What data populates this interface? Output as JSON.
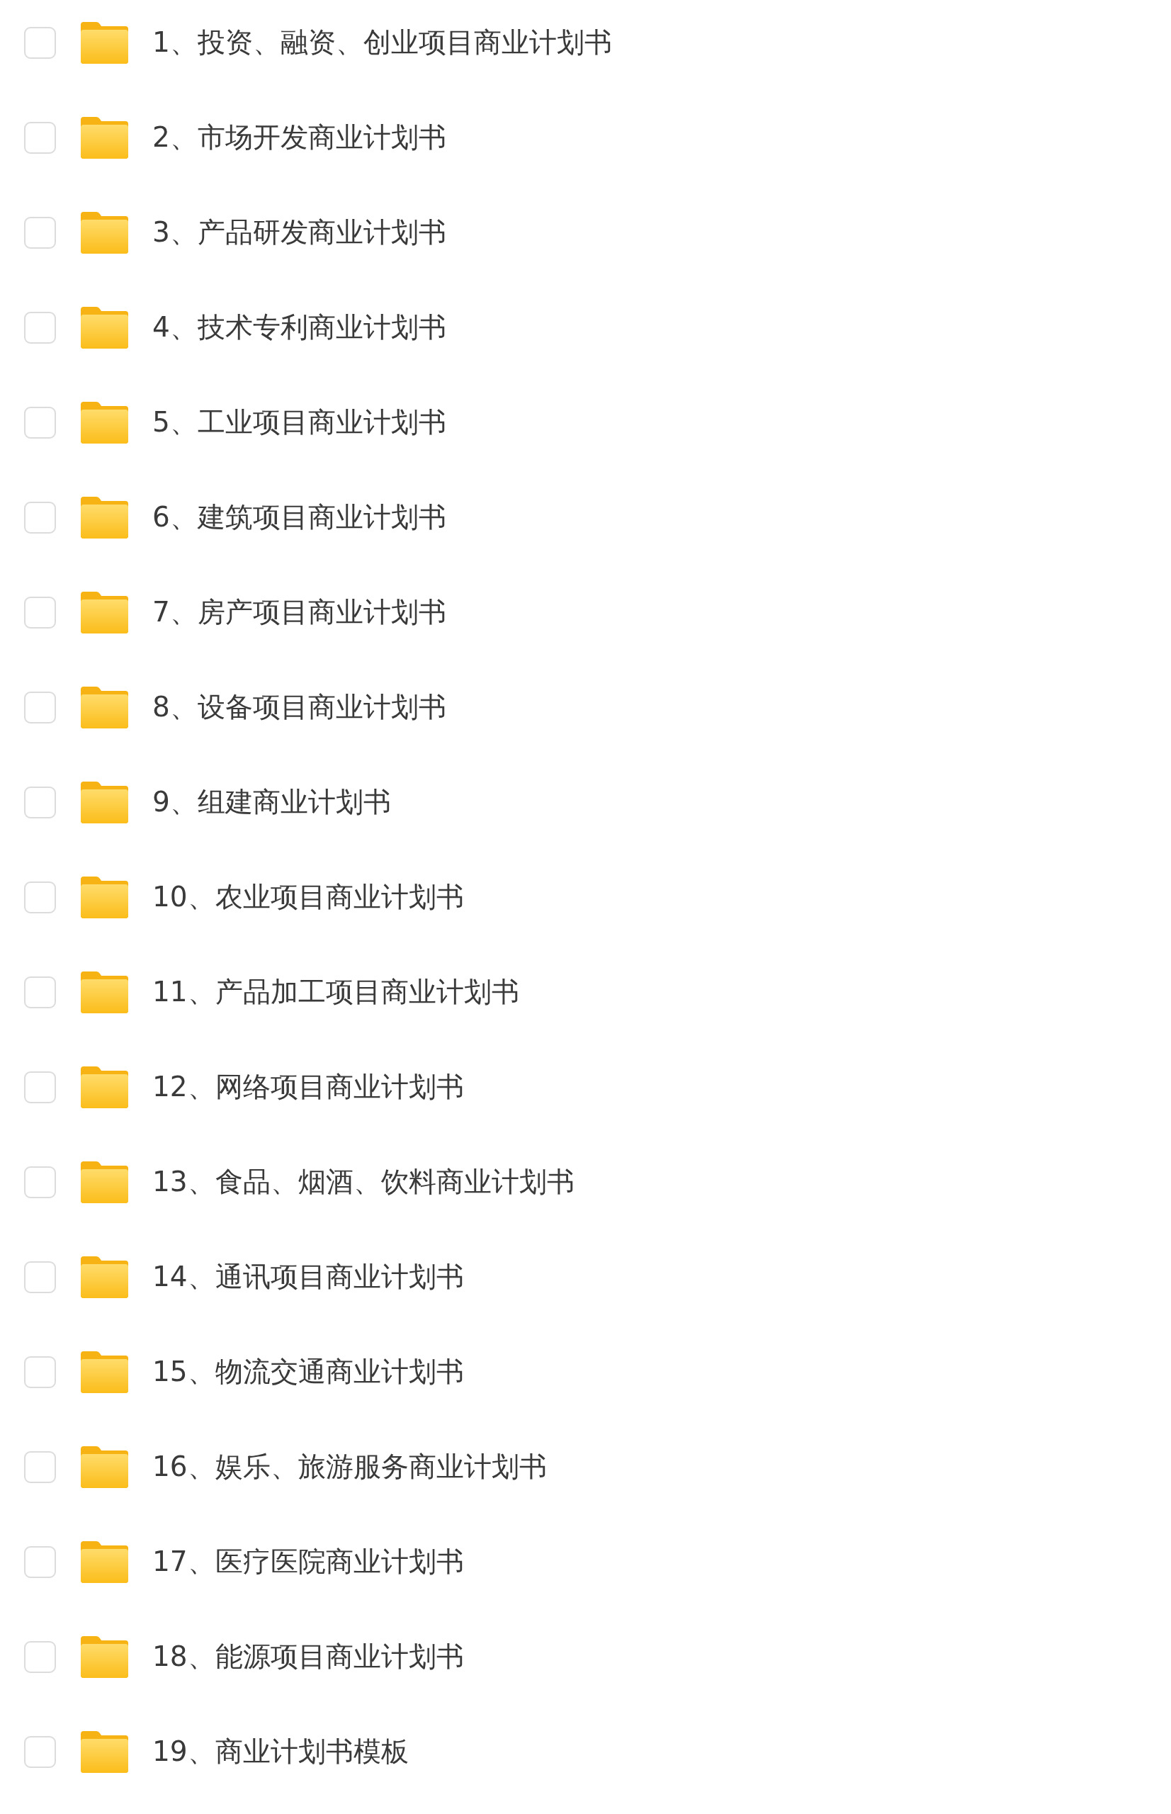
{
  "items": [
    {
      "label": "1、投资、融资、创业项目商业计划书",
      "checked": false
    },
    {
      "label": "2、市场开发商业计划书",
      "checked": false
    },
    {
      "label": "3、产品研发商业计划书",
      "checked": false
    },
    {
      "label": "4、技术专利商业计划书",
      "checked": false
    },
    {
      "label": "5、工业项目商业计划书",
      "checked": false
    },
    {
      "label": "6、建筑项目商业计划书",
      "checked": false
    },
    {
      "label": "7、房产项目商业计划书",
      "checked": false
    },
    {
      "label": "8、设备项目商业计划书",
      "checked": false
    },
    {
      "label": "9、组建商业计划书",
      "checked": false
    },
    {
      "label": "10、农业项目商业计划书",
      "checked": false
    },
    {
      "label": "11、产品加工项目商业计划书",
      "checked": false
    },
    {
      "label": "12、网络项目商业计划书",
      "checked": false
    },
    {
      "label": "13、食品、烟酒、饮料商业计划书",
      "checked": false
    },
    {
      "label": "14、通讯项目商业计划书",
      "checked": false
    },
    {
      "label": "15、物流交通商业计划书",
      "checked": false
    },
    {
      "label": "16、娱乐、旅游服务商业计划书",
      "checked": false
    },
    {
      "label": "17、医疗医院商业计划书",
      "checked": false
    },
    {
      "label": "18、能源项目商业计划书",
      "checked": false
    },
    {
      "label": "19、商业计划书模板",
      "checked": false
    }
  ]
}
